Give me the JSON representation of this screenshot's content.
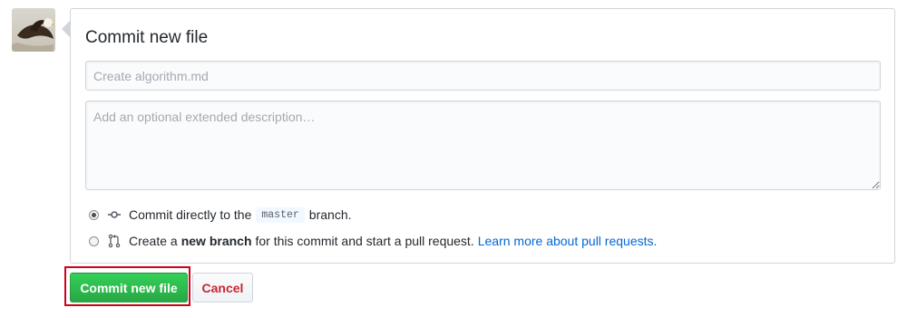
{
  "commit_form": {
    "title": "Commit new file",
    "summary_placeholder": "Create algorithm.md",
    "summary_value": "",
    "description_placeholder": "Add an optional extended description…",
    "description_value": ""
  },
  "options": {
    "direct": {
      "selected": true,
      "prefix": "Commit directly to the",
      "branch": "master",
      "suffix": "branch.",
      "icon": "git-commit-icon"
    },
    "new_branch": {
      "selected": false,
      "prefix": "Create a",
      "bold": "new branch",
      "middle": "for this commit and start a pull request.",
      "link": "Learn more about pull requests.",
      "icon": "git-pull-request-icon"
    }
  },
  "actions": {
    "commit_label": "Commit new file",
    "cancel_label": "Cancel"
  },
  "colors": {
    "primary_button": "#28a745",
    "cancel_text": "#cb2431",
    "link": "#0366d6",
    "highlight": "#d0021b"
  }
}
